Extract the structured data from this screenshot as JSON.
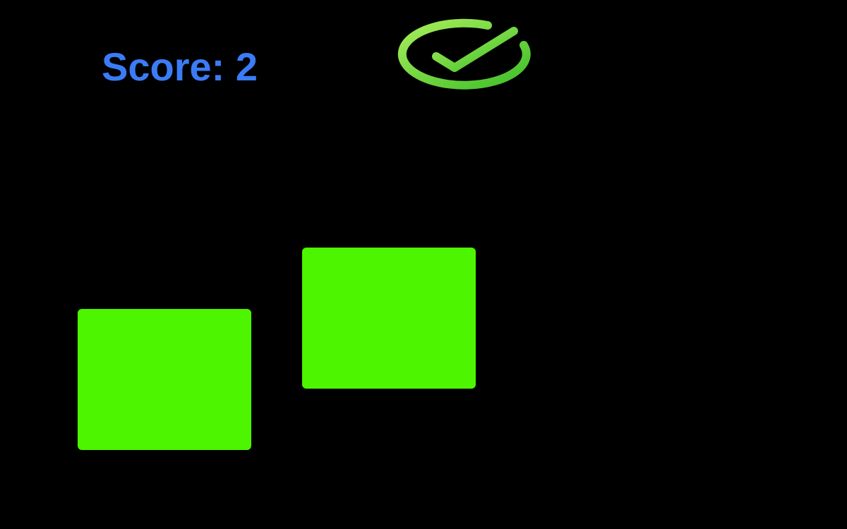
{
  "hud": {
    "score_label": "Score:",
    "score_value": "2"
  },
  "icons": {
    "status": "check-circle-icon"
  },
  "colors": {
    "background": "#000000",
    "score_text": "#3b7cf6",
    "tile": "#4df500",
    "check_ring_light": "#8ee84a",
    "check_ring_dark": "#3fbf2a"
  },
  "tiles": [
    {
      "name": "green-tile-left"
    },
    {
      "name": "green-tile-right"
    }
  ]
}
